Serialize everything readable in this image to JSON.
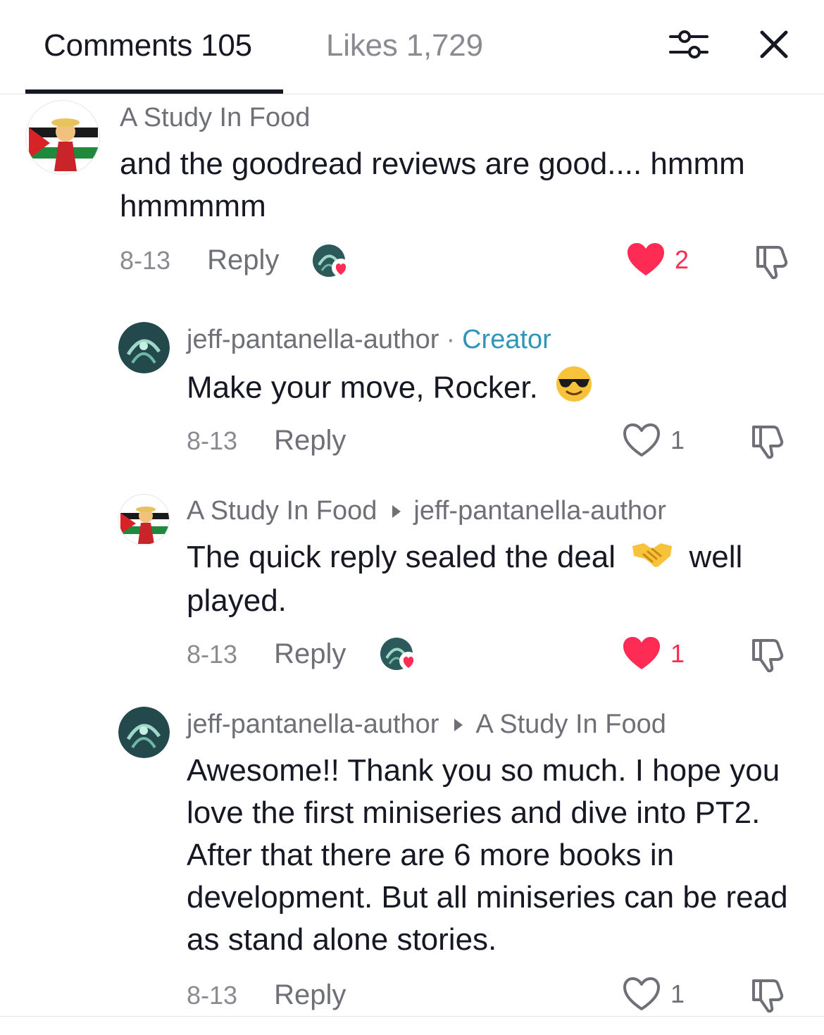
{
  "header": {
    "comments_tab": "Comments 105",
    "likes_tab": "Likes 1,729",
    "filter_icon": "filter-sliders-icon",
    "close_icon": "close-icon"
  },
  "colors": {
    "like_red": "#fe2c55",
    "creator_blue": "#2f96b8",
    "meta_gray": "#8a8b91"
  },
  "comments": [
    {
      "author": "A Study In Food",
      "text": "and the goodread reviews are good.... hmmm hmmmmm",
      "date": "8-13",
      "reply": "Reply",
      "likes": "2",
      "liked": true,
      "liked_by_creator": true
    },
    {
      "author": "jeff-pantanella-author",
      "separator": "·",
      "badge": "Creator",
      "text": "Make your move, Rocker.",
      "emoji": "sunglasses-emoji",
      "date": "8-13",
      "reply": "Reply",
      "likes": "1",
      "liked": false
    },
    {
      "author": "A Study In Food",
      "reply_to": "jeff-pantanella-author",
      "text_before": "The quick reply sealed the deal",
      "emoji": "handshake-emoji",
      "text_after": "well played.",
      "date": "8-13",
      "reply": "Reply",
      "likes": "1",
      "liked": true,
      "liked_by_creator": true
    },
    {
      "author": "jeff-pantanella-author",
      "reply_to": "A Study In Food",
      "text": "Awesome!! Thank you so much. I hope you love the first miniseries and dive into PT2. After that there are 6 more books in development. But all miniseries can be read as stand alone stories.",
      "date": "8-13",
      "reply": "Reply",
      "likes": "1",
      "liked": false
    }
  ]
}
